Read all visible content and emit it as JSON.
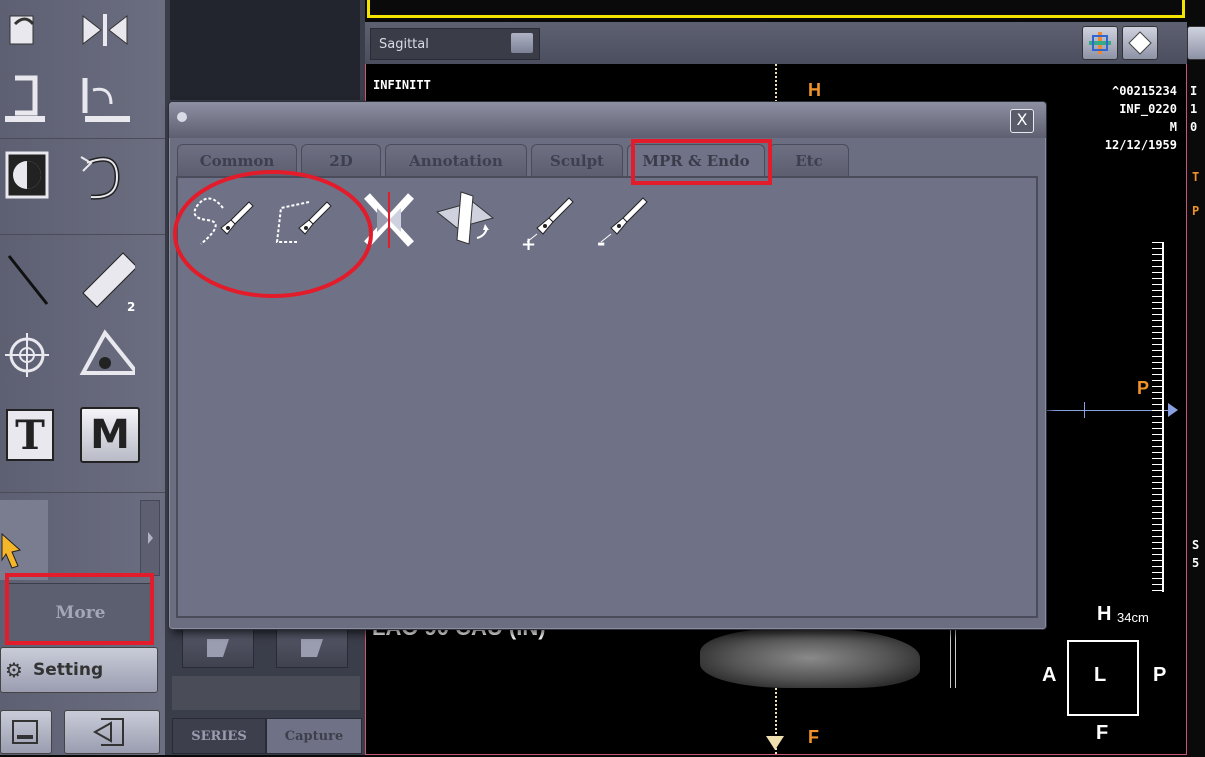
{
  "left_toolbar": {
    "more_label": "More",
    "setting_label": "Setting",
    "tools": [
      "flip-horizontal-icon",
      "flip-vertical-icon",
      "mirror-icon",
      "rotate-icon",
      "invert-icon",
      "undo-rotate-icon",
      "line-icon",
      "ruler-2d-icon",
      "crosshair-icon",
      "angle-icon",
      "text-icon",
      "marker-m-icon",
      "pointer-icon"
    ],
    "text_tool_glyph": "T",
    "marker_tool_glyph": "M",
    "ruler_badge": "2D"
  },
  "series_panel": {
    "tabs": [
      "SERIES",
      "Capture"
    ]
  },
  "viewport": {
    "plane": "Sagittal",
    "institution": "INFINITT",
    "patient_id": "^00215234",
    "accession": "INF_0220",
    "sex": "M",
    "dob": "12/12/1959",
    "orientation_top": "H",
    "orientation_bottom": "F",
    "orientation_right": "P",
    "projection": "LAO 90 CAU (IN)",
    "scale": "34cm",
    "cube": {
      "top": "H",
      "left": "A",
      "center": "L",
      "right": "P",
      "bottom": "F"
    },
    "right_edge_text": [
      "I",
      "1",
      "0",
      "T",
      "P",
      "S",
      "5"
    ]
  },
  "dialog": {
    "close_symbol": "X",
    "tabs": [
      "Common",
      "2D",
      "Annotation",
      "Sculpt",
      "MPR & Endo",
      "Etc"
    ],
    "active_tab": "MPR & Endo",
    "tools": [
      "freehand-curve-pen-icon",
      "polyline-curve-pen-icon",
      "cut-plane-icon",
      "rotate-plane-icon",
      "add-point-pen-icon",
      "remove-point-pen-icon"
    ],
    "add_sign": "+",
    "remove_sign": "-"
  },
  "annotations": {
    "highlight_color": "#e21c2a"
  }
}
